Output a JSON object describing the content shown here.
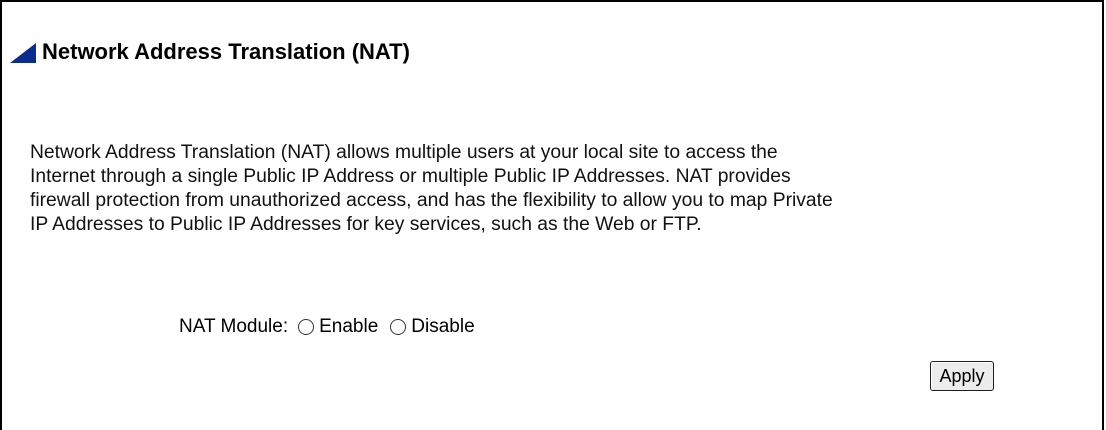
{
  "page": {
    "title": "Network Address Translation (NAT)",
    "description_lines": [
      "Network Address Translation (NAT) allows multiple users at your local site to access the",
      "Internet through a single Public IP Address or multiple Public IP Addresses. NAT provides",
      "firewall protection from unauthorized access, and has the flexibility to allow you to map Private",
      "IP Addresses to Public IP Addresses for key services, such as the Web or FTP."
    ]
  },
  "nat_module": {
    "label": "NAT Module:",
    "options": [
      "Enable",
      "Disable"
    ]
  },
  "actions": {
    "apply_label": "Apply"
  },
  "colors": {
    "marker": "#0b2d8f",
    "border": "#000000"
  },
  "icons": {
    "title_marker": "triangle-marker-icon"
  }
}
